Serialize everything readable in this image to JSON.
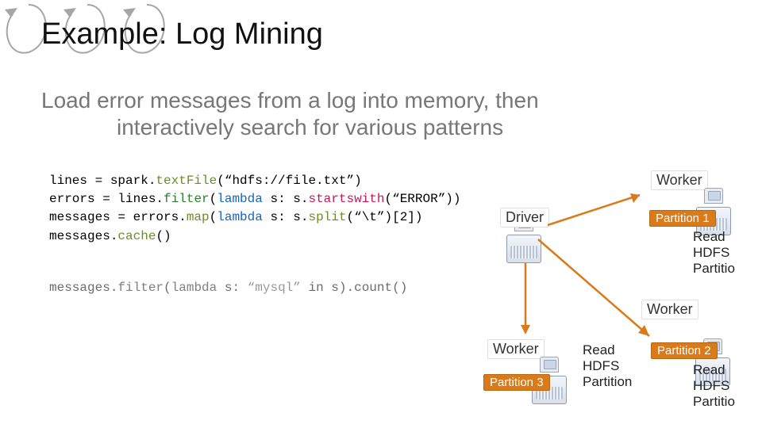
{
  "title": "Example: Log Mining",
  "subtitle_line1": "Load error messages from a log into memory, then",
  "subtitle_line2": "interactively search for various patterns",
  "code": {
    "l1a": "lines = spark.",
    "l1b": "textFile",
    "l1c": "(“hdfs://file.txt”)",
    "l2a": "errors = lines.",
    "l2b": "filter",
    "l2c": "(",
    "l2d": "lambda",
    "l2e": " s: s.",
    "l2f": "startswith",
    "l2g": "(“ERROR”)",
    "l2h": ")",
    "l3a": "messages = errors.",
    "l3b": "map",
    "l3c": "(",
    "l3d": "lambda",
    "l3e": " s: s.",
    "l3f": "split",
    "l3g": "(“\\t”)[2]",
    "l3h": ")",
    "l4a": "messages.",
    "l4b": "cache",
    "l4c": "()",
    "q1a": "messages.",
    "q1b": "filter",
    "q1c": "(",
    "q1d": "lambda",
    "q1e": " s: ",
    "q1f": "“mysql”",
    "q1g": " in s).",
    "q1h": "count",
    "q1i": "()"
  },
  "labels": {
    "driver": "Driver",
    "worker": "Worker",
    "partition1": "Partition 1",
    "partition2": "Partition 2",
    "partition3": "Partition 3",
    "read": "Read",
    "hdfs": "HDFS",
    "partition": "Partition",
    "partition_clip": "Partitio"
  }
}
